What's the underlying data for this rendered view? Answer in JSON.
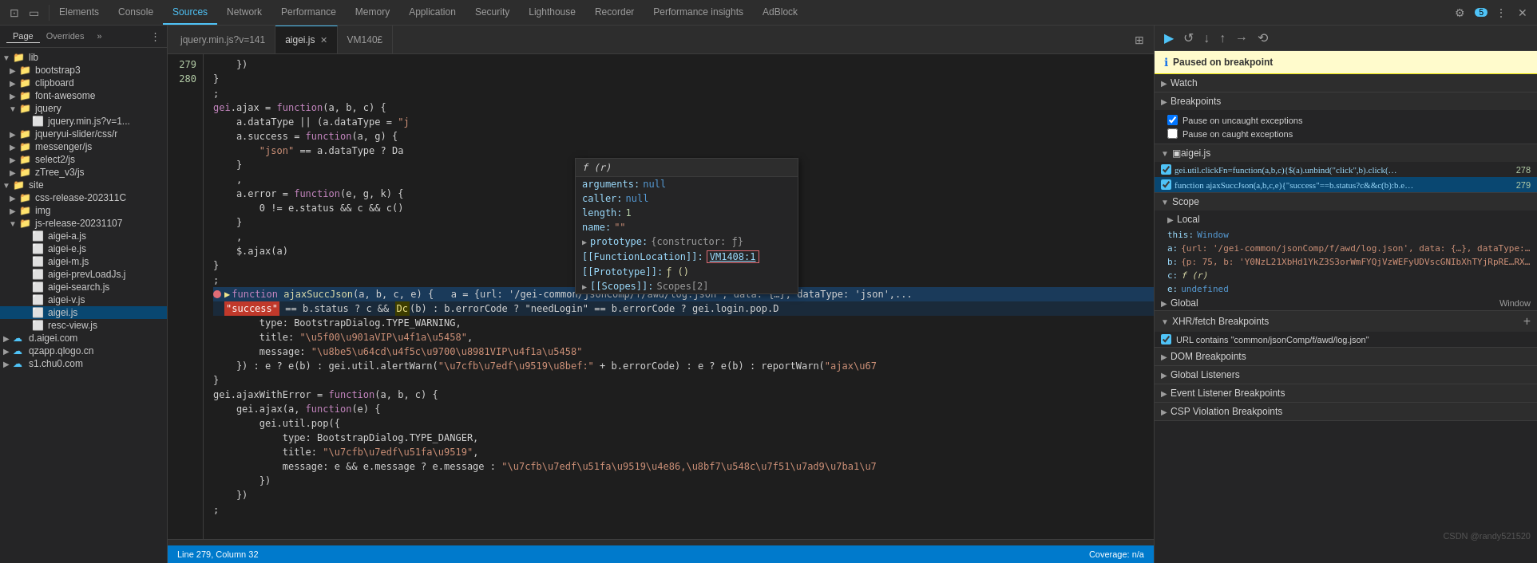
{
  "nav": {
    "items": [
      {
        "label": "Elements",
        "active": false
      },
      {
        "label": "Console",
        "active": false
      },
      {
        "label": "Sources",
        "active": true
      },
      {
        "label": "Network",
        "active": false
      },
      {
        "label": "Performance",
        "active": false
      },
      {
        "label": "Memory",
        "active": false
      },
      {
        "label": "Application",
        "active": false
      },
      {
        "label": "Security",
        "active": false
      },
      {
        "label": "Lighthouse",
        "active": false
      },
      {
        "label": "Recorder",
        "active": false
      },
      {
        "label": "Performance insights",
        "active": false
      },
      {
        "label": "AdBlock",
        "active": false
      }
    ],
    "badge": "5"
  },
  "sidebar": {
    "tabs": [
      {
        "label": "Page",
        "active": true
      },
      {
        "label": "Overrides",
        "active": false
      }
    ],
    "tree": [
      {
        "indent": 0,
        "type": "folder",
        "label": "lib",
        "expanded": true
      },
      {
        "indent": 1,
        "type": "folder",
        "label": "bootstrap3",
        "expanded": false
      },
      {
        "indent": 1,
        "type": "folder",
        "label": "clipboard",
        "expanded": false
      },
      {
        "indent": 1,
        "type": "folder",
        "label": "font-awesome",
        "expanded": false
      },
      {
        "indent": 1,
        "type": "folder",
        "label": "jquery",
        "expanded": true
      },
      {
        "indent": 2,
        "type": "file",
        "label": "jquery.min.js?v=1...",
        "active": false
      },
      {
        "indent": 1,
        "type": "folder",
        "label": "jqueryui-slider/css/r",
        "expanded": false
      },
      {
        "indent": 1,
        "type": "folder",
        "label": "messenger/js",
        "expanded": false
      },
      {
        "indent": 1,
        "type": "folder",
        "label": "select2/js",
        "expanded": false
      },
      {
        "indent": 1,
        "type": "folder",
        "label": "zTree_v3/js",
        "expanded": false
      },
      {
        "indent": 0,
        "type": "folder",
        "label": "site",
        "expanded": true
      },
      {
        "indent": 1,
        "type": "folder",
        "label": "css-release-202311C",
        "expanded": false
      },
      {
        "indent": 1,
        "type": "folder",
        "label": "img",
        "expanded": false
      },
      {
        "indent": 1,
        "type": "folder",
        "label": "js-release-20231107",
        "expanded": true
      },
      {
        "indent": 2,
        "type": "file",
        "label": "aigei-a.js",
        "active": false
      },
      {
        "indent": 2,
        "type": "file",
        "label": "aigei-e.js",
        "active": false
      },
      {
        "indent": 2,
        "type": "file",
        "label": "aigei-m.js",
        "active": false
      },
      {
        "indent": 2,
        "type": "file",
        "label": "aigei-prevLoadJs.j",
        "active": false
      },
      {
        "indent": 2,
        "type": "file",
        "label": "aigei-search.js",
        "active": false
      },
      {
        "indent": 2,
        "type": "file",
        "label": "aigei-v.js",
        "active": false
      },
      {
        "indent": 2,
        "type": "file",
        "label": "aigei.js",
        "active": true
      },
      {
        "indent": 2,
        "type": "file",
        "label": "resc-view.js",
        "active": false
      },
      {
        "indent": 0,
        "type": "domain",
        "label": "d.aigei.com",
        "expanded": false
      },
      {
        "indent": 0,
        "type": "domain",
        "label": "qzapp.qlogo.cn",
        "expanded": false
      },
      {
        "indent": 0,
        "type": "domain",
        "label": "s1.chu0.com",
        "expanded": false
      }
    ]
  },
  "tabs": [
    {
      "label": "jquery.min.js?v=141",
      "active": false,
      "closable": false
    },
    {
      "label": "aigei.js",
      "active": true,
      "closable": true
    },
    {
      "label": "VM140£",
      "active": false,
      "closable": false
    }
  ],
  "code": {
    "lines": [
      {
        "num": "",
        "content": "    })",
        "indent": 8,
        "type": "plain"
      },
      {
        "num": "",
        "content": "}",
        "indent": 4,
        "type": "plain"
      },
      {
        "num": "",
        "content": ";",
        "indent": 0,
        "type": "plain"
      },
      {
        "num": "",
        "content": "gei.ajax = function(a, b, c) {",
        "indent": 0,
        "type": "plain"
      },
      {
        "num": "",
        "content": "    a.dataType || (a.dataType = \"j",
        "indent": 4,
        "type": "plain"
      },
      {
        "num": "",
        "content": "    a.success = function(a, g) {",
        "indent": 4,
        "type": "plain"
      },
      {
        "num": "",
        "content": "        \"json\" == a.dataType ? Da",
        "indent": 8,
        "type": "plain"
      },
      {
        "num": "",
        "content": "    }",
        "indent": 4,
        "type": "plain"
      },
      {
        "num": "",
        "content": "    ,",
        "indent": 4,
        "type": "plain"
      },
      {
        "num": "",
        "content": "    a.error = function(e, g, k) {",
        "indent": 4,
        "type": "plain"
      },
      {
        "num": "",
        "content": "        0 != e.status && c && c()",
        "indent": 8,
        "type": "plain"
      },
      {
        "num": "",
        "content": "    }",
        "indent": 4,
        "type": "plain"
      },
      {
        "num": "",
        "content": "    ,",
        "indent": 4,
        "type": "plain"
      },
      {
        "num": "",
        "content": "    $.ajax(a)",
        "indent": 4,
        "type": "plain"
      },
      {
        "num": "",
        "content": "}",
        "indent": 0,
        "type": "plain"
      },
      {
        "num": "",
        "content": ";",
        "indent": 0,
        "type": "plain"
      },
      {
        "num": "279",
        "content": "function ajaxSuccJson(a, b, c, e) {",
        "indent": 0,
        "type": "plain",
        "breakpoint": true,
        "arrow": true,
        "highlighted": true
      },
      {
        "num": "",
        "content": "    \"success\" == b.status ? c && Dc(b) : b.errorCode ? \"needLogin\" == b.errorCode ? gei.login.pop.D",
        "indent": 4,
        "type": "plain",
        "highlighted": true
      },
      {
        "num": "",
        "content": "        type: BootstrapDialog.TYPE_WARNING,",
        "indent": 8,
        "type": "plain"
      },
      {
        "num": "",
        "content": "        title: \"\\u5f00\\u901aVIP\\u4f1a\\u5458\",",
        "indent": 8,
        "type": "plain"
      },
      {
        "num": "",
        "content": "        message: \"\\u8be5\\u64cd\\u4f5c\\u9700\\u8981VIP\\u4f1a\\u5458\"",
        "indent": 8,
        "type": "plain"
      },
      {
        "num": "",
        "content": "    }) : e ? e(b) : gei.util.alertWarn(\"\\u7cfb\\u7edf\\u9519\\u8bef:\" + b.errorCode) : e ? e(b) : reportWarn(\"ajax\\u67",
        "indent": 4,
        "type": "plain"
      },
      {
        "num": "",
        "content": "}",
        "indent": 0,
        "type": "plain"
      },
      {
        "num": "280",
        "content": "gei.ajaxWithError = function(a, b, c) {",
        "indent": 0,
        "type": "plain"
      },
      {
        "num": "",
        "content": "    gei.ajax(a, function(e) {",
        "indent": 4,
        "type": "plain"
      },
      {
        "num": "",
        "content": "        gei.util.pop({",
        "indent": 8,
        "type": "plain"
      },
      {
        "num": "",
        "content": "            type: BootstrapDialog.TYPE_DANGER,",
        "indent": 12,
        "type": "plain"
      },
      {
        "num": "",
        "content": "            title: \"\\u7cfb\\u7edf\\u51fa\\u9519\",",
        "indent": 12,
        "type": "plain"
      },
      {
        "num": "",
        "content": "            message: e && e.message ? e.message : \"\\u7cfb\\u7edf\\u51fa\\u9519\\u4e86,\\u8bf7\\u548c\\u7f51\\u7ad9\\u7ba1\\u7",
        "indent": 12,
        "type": "plain"
      },
      {
        "num": "",
        "content": "        })",
        "indent": 8,
        "type": "plain"
      },
      {
        "num": "",
        "content": "    })",
        "indent": 4,
        "type": "plain"
      },
      {
        "num": "",
        "content": ";",
        "indent": 0,
        "type": "plain"
      }
    ]
  },
  "tooltip": {
    "header": "f (r)",
    "rows": [
      {
        "key": "arguments:",
        "val": "null",
        "type": "null"
      },
      {
        "key": "caller:",
        "val": "null",
        "type": "null"
      },
      {
        "key": "length:",
        "val": "1",
        "type": "num"
      },
      {
        "key": "name:",
        "val": "\"\"",
        "type": "str"
      },
      {
        "key": "► prototype:",
        "val": "{constructor: ƒ}",
        "type": "obj",
        "expandable": true
      },
      {
        "key": "[[FunctionLocation]]:",
        "val": "VM1408:1",
        "type": "link"
      },
      {
        "key": "[[Prototype]]:",
        "val": "ƒ ()",
        "type": "fn"
      },
      {
        "key": "► [[Scopes]]:",
        "val": "Scopes[2]",
        "type": "obj"
      }
    ]
  },
  "debugger": {
    "toolbar_buttons": [
      "resume",
      "step-over",
      "step-into",
      "step-out",
      "step",
      "deactivate"
    ],
    "breakpoint_label": "Paused on breakpoint",
    "sections": {
      "watch": {
        "title": "Watch",
        "expanded": false
      },
      "breakpoints": {
        "title": "Breakpoints",
        "expanded": true,
        "items": [
          {
            "checked": true,
            "label": "Pause on uncaught exceptions"
          },
          {
            "checked": false,
            "label": "Pause on caught exceptions"
          }
        ]
      },
      "call_stack": {
        "title": "aigei.js",
        "expanded": true,
        "items": [
          {
            "fn": "gei.util.clickFn=function(a,b,c){$(a).unbind(\"click\",b).click(…",
            "num": "278",
            "active": false
          },
          {
            "fn": "function ajaxSuccJson(a,b,c,e){\"success\"==b.status?c&&c(b):b.e…",
            "num": "279",
            "active": true
          }
        ]
      },
      "scope": {
        "title": "Scope",
        "expanded": true,
        "local": {
          "title": "Local",
          "items": [
            {
              "key": "this:",
              "val": "Window"
            },
            {
              "key": "a:",
              "val": "{url: '/gei-common/jsonComp/f/awd/log.json', data: {…}, dataType: 'j"
            },
            {
              "key": "b:",
              "val": "{p: 75, b: 'Y0NzL21XbHd1YkZ3S3orWmFYQjVzWEFyUDVscGNIbXhTYjRpRE…RXpxZ"
            },
            {
              "key": "c:",
              "val": "f (r)"
            },
            {
              "key": "e:",
              "val": "undefined"
            }
          ]
        },
        "global": {
          "title": "Global",
          "val": "Window"
        }
      },
      "xhr_breakpoints": {
        "title": "XHR/fetch Breakpoints",
        "expanded": true,
        "items": [
          {
            "checked": true,
            "label": "URL contains \"common/jsonComp/f/awd/log.json\""
          }
        ]
      },
      "dom_breakpoints": {
        "title": "DOM Breakpoints",
        "expanded": false
      },
      "global_listeners": {
        "title": "Global Listeners",
        "expanded": false
      },
      "event_listeners": {
        "title": "Event Listener Breakpoints",
        "expanded": false
      },
      "csp_violations": {
        "title": "CSP Violation Breakpoints",
        "expanded": false
      }
    }
  },
  "status": {
    "left": "Line 279, Column 32",
    "right": "Coverage: n/a"
  },
  "watermark": "CSDN @randy521520"
}
